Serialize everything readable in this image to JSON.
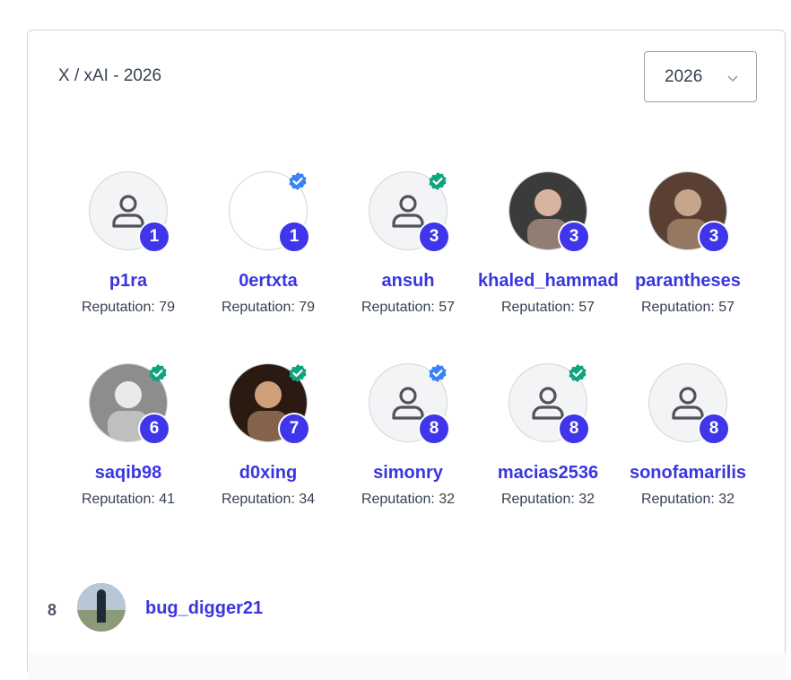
{
  "header": {
    "title": "X / xAI - 2026"
  },
  "year_select": {
    "value": "2026"
  },
  "rep_prefix": "Reputation: ",
  "users": [
    {
      "name": "p1ra",
      "rep": "Reputation: 79",
      "rank": "1",
      "avatar": "default-avatar",
      "verified": ""
    },
    {
      "name": "0ertxta",
      "rep": "Reputation: 79",
      "rank": "1",
      "avatar": "blank-avatar",
      "verified": "blue"
    },
    {
      "name": "ansuh",
      "rep": "Reputation: 57",
      "rank": "3",
      "avatar": "default-avatar",
      "verified": "green"
    },
    {
      "name": "khaled_hammad",
      "rep": "Reputation: 57",
      "rank": "3",
      "avatar": "photo-avatar",
      "verified": ""
    },
    {
      "name": "parantheses",
      "rep": "Reputation: 57",
      "rank": "3",
      "avatar": "photo-avatar",
      "verified": ""
    },
    {
      "name": "saqib98",
      "rep": "Reputation: 41",
      "rank": "6",
      "avatar": "photo-avatar",
      "verified": "green"
    },
    {
      "name": "d0xing",
      "rep": "Reputation: 34",
      "rank": "7",
      "avatar": "photo-avatar",
      "verified": "green"
    },
    {
      "name": "simonry",
      "rep": "Reputation: 32",
      "rank": "8",
      "avatar": "default-avatar",
      "verified": "blue"
    },
    {
      "name": "macias2536",
      "rep": "Reputation: 32",
      "rank": "8",
      "avatar": "default-avatar",
      "verified": "green"
    },
    {
      "name": "sonofamarilis",
      "rep": "Reputation: 32",
      "rank": "8",
      "avatar": "default-avatar",
      "verified": ""
    }
  ],
  "list_row": {
    "rank": "8",
    "name": "bug_digger21"
  },
  "colors": {
    "accent": "#3f35ea",
    "verified_blue": "#3b82f6",
    "verified_green": "#10a37f"
  }
}
